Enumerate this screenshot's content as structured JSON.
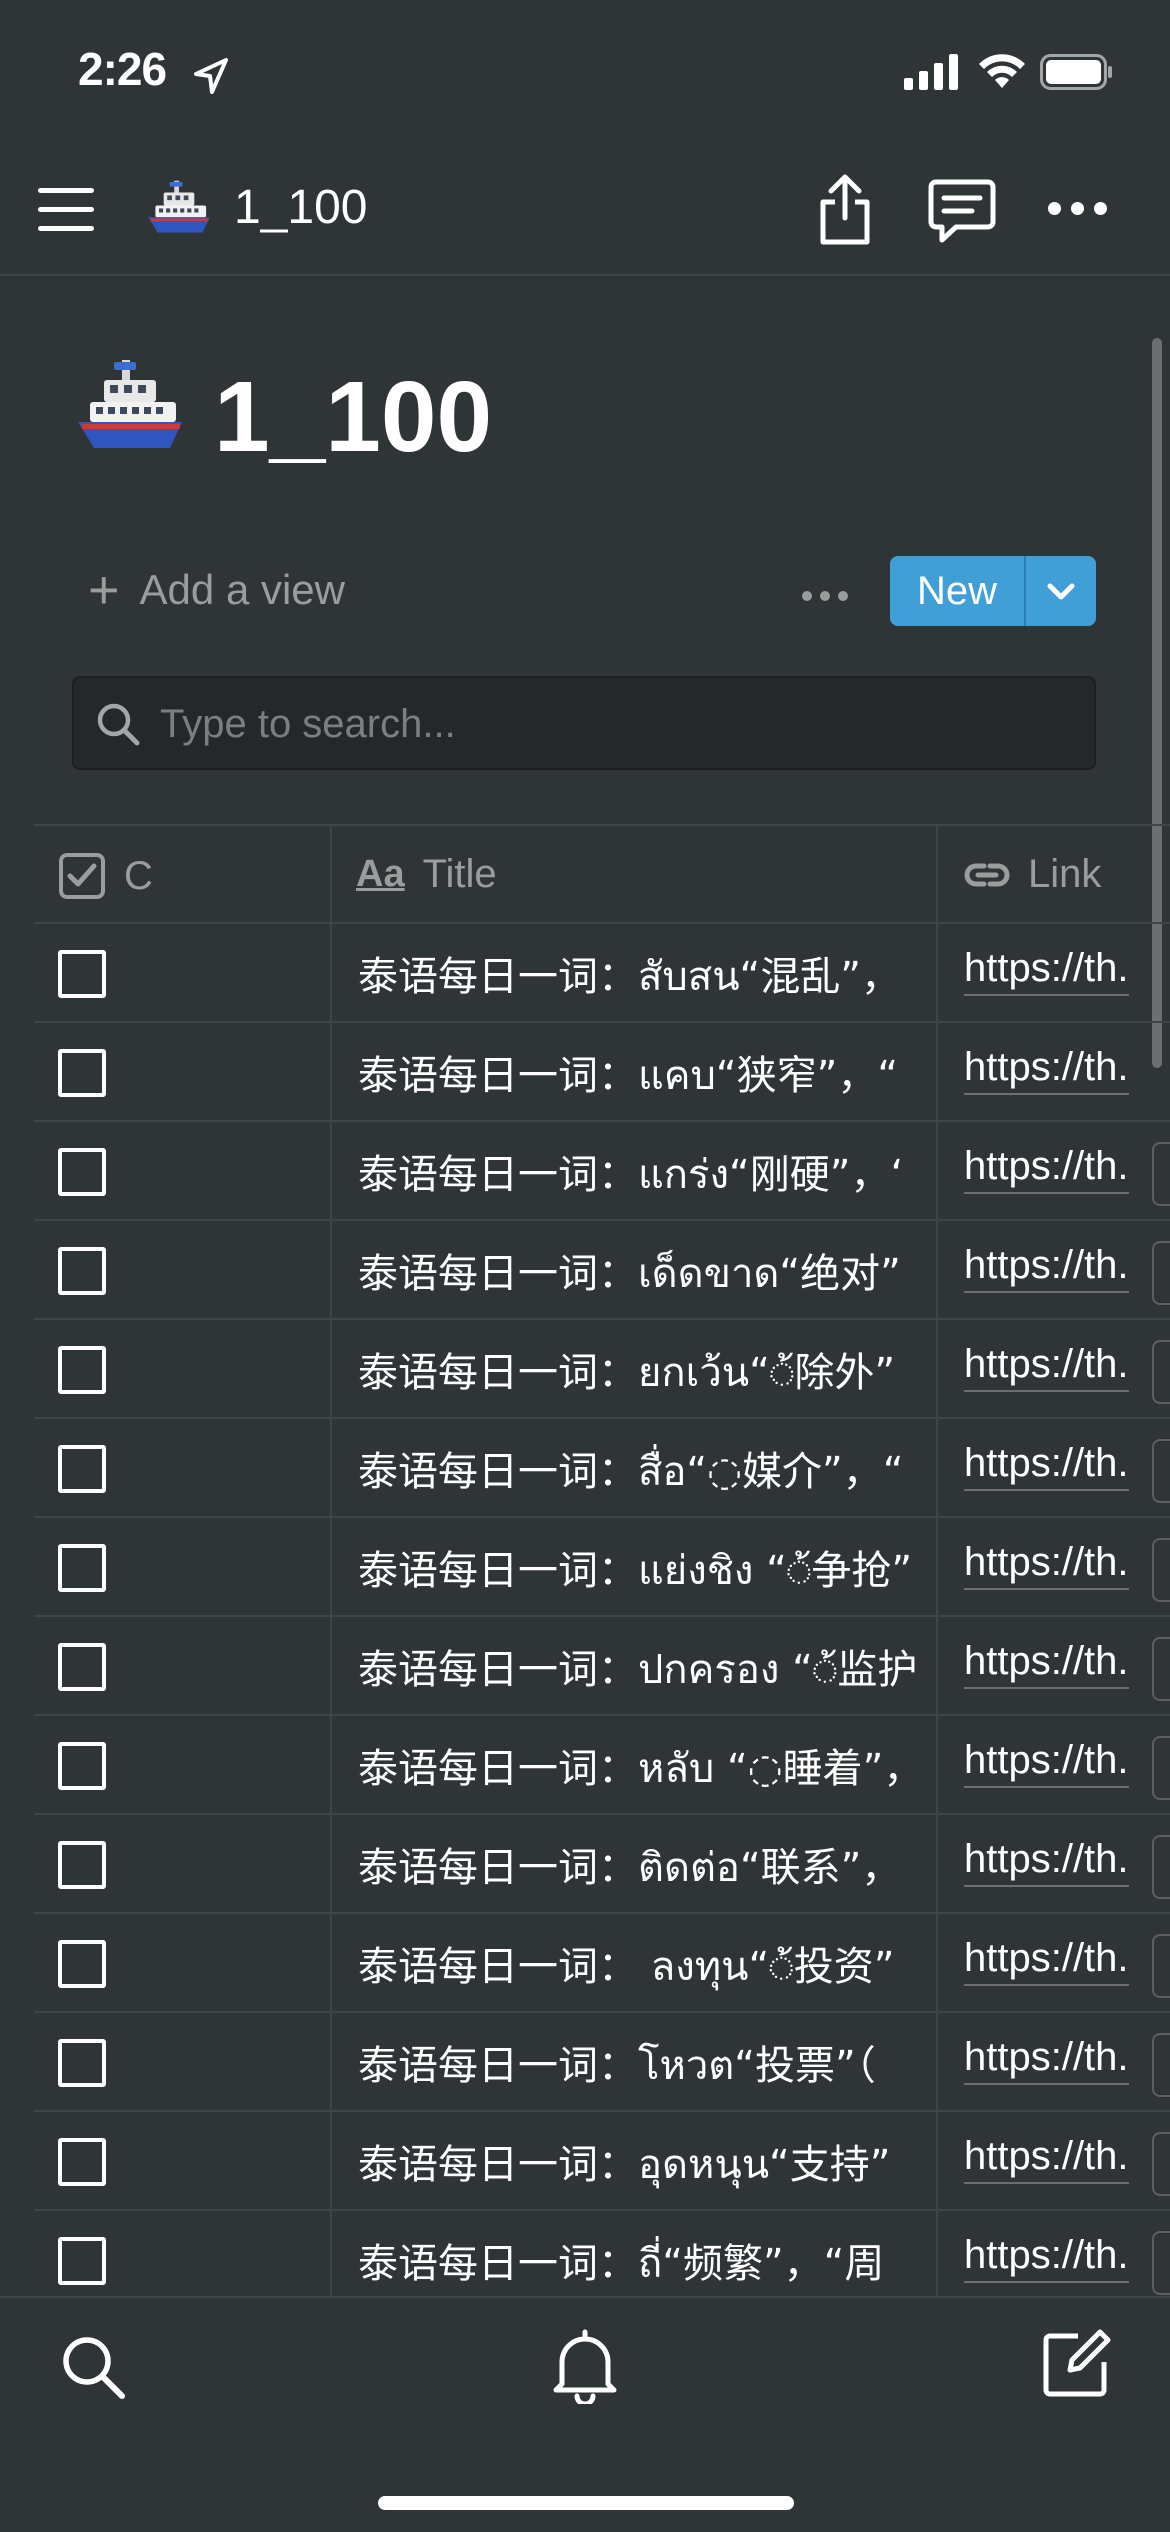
{
  "status_bar": {
    "time": "2:26"
  },
  "nav": {
    "title": "1_100",
    "page_icon": "ferry-emoji",
    "icons": [
      "menu-icon",
      "share-icon",
      "comment-icon",
      "more-icon"
    ]
  },
  "page": {
    "title": "1_100",
    "page_icon": "ferry-emoji"
  },
  "views": {
    "add_view_label": "Add a view",
    "new_button_label": "New"
  },
  "search": {
    "placeholder": "Type to search..."
  },
  "table": {
    "columns": [
      {
        "label": "C",
        "icon": "checkbox-property-icon"
      },
      {
        "label": "Title",
        "icon": "text-aa-icon"
      },
      {
        "label": "Link",
        "icon": "link-icon"
      }
    ],
    "rows": [
      {
        "checked": false,
        "title": "泰语每日一词：สับสน“混乱”，",
        "link": "https://th."
      },
      {
        "checked": false,
        "title": "泰语每日一词：แคบ“狭窄”，“",
        "link": "https://th."
      },
      {
        "checked": false,
        "title": "泰语每日一词：แกร่ง“刚硬”，‘",
        "link": "https://th."
      },
      {
        "checked": false,
        "title": "泰语每日一词：เด็ดขาด“绝对”",
        "link": "https://th."
      },
      {
        "checked": false,
        "title": "泰语每日一词：ยกเว้น“◌้除外”",
        "link": "https://th."
      },
      {
        "checked": false,
        "title": "泰语每日一词：สื่อ“◌媒介”，“",
        "link": "https://th."
      },
      {
        "checked": false,
        "title": "泰语每日一词：แย่งชิง “◌้争抢”",
        "link": "https://th."
      },
      {
        "checked": false,
        "title": "泰语每日一词：ปกครอง “◌้监护",
        "link": "https://th."
      },
      {
        "checked": false,
        "title": "泰语每日一词：หลับ “◌睡着”，",
        "link": "https://th."
      },
      {
        "checked": false,
        "title": "泰语每日一词：ติดต่อ“联系”，",
        "link": "https://th."
      },
      {
        "checked": false,
        "title": "泰语每日一词： ลงทุน“◌้投资”",
        "link": "https://th."
      },
      {
        "checked": false,
        "title": "泰语每日一词：โหวต“投票”（",
        "link": "https://th."
      },
      {
        "checked": false,
        "title": "泰语每日一词：อุดหนุน“支持”",
        "link": "https://th."
      },
      {
        "checked": false,
        "title": "泰语每日一词：ถี่“频繁”，“周",
        "link": "https://th."
      }
    ]
  },
  "bottom_bar": {
    "icons": [
      "search-icon",
      "bell-icon",
      "compose-icon"
    ]
  },
  "colors": {
    "background": "#2f3437",
    "accent": "#3f9fd6",
    "divider": "#3f4447",
    "muted_text": "#9b9c9c"
  }
}
